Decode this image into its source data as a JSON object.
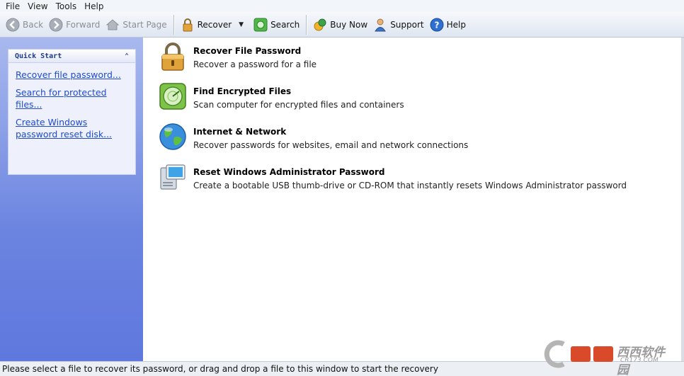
{
  "menu": [
    "File",
    "View",
    "Tools",
    "Help"
  ],
  "toolbar": {
    "back": "Back",
    "forward": "Forward",
    "start_page": "Start Page",
    "recover": "Recover",
    "search": "Search",
    "buy_now": "Buy Now",
    "support": "Support",
    "help": "Help"
  },
  "quick_start": {
    "title": "Quick Start",
    "links": [
      "Recover file password...",
      "Search for protected files...",
      "Create Windows password reset disk..."
    ]
  },
  "items": [
    {
      "title": "Recover File Password",
      "desc": "Recover a password for a file",
      "icon": "lock-icon"
    },
    {
      "title": "Find Encrypted Files",
      "desc": "Scan computer for encrypted files and containers",
      "icon": "radar-icon"
    },
    {
      "title": "Internet & Network",
      "desc": "Recover passwords for websites, email and network connections",
      "icon": "globe-icon"
    },
    {
      "title": "Reset Windows Administrator Password",
      "desc": "Create a bootable USB thumb-drive or CD-ROM that instantly resets Windows Administrator password",
      "icon": "computer-icon"
    }
  ],
  "status": "Please select a file to recover its password, or drag and drop a file to this window to start the recovery",
  "watermark": {
    "text1": "西西软件园",
    "text2": "CR173.COM"
  }
}
